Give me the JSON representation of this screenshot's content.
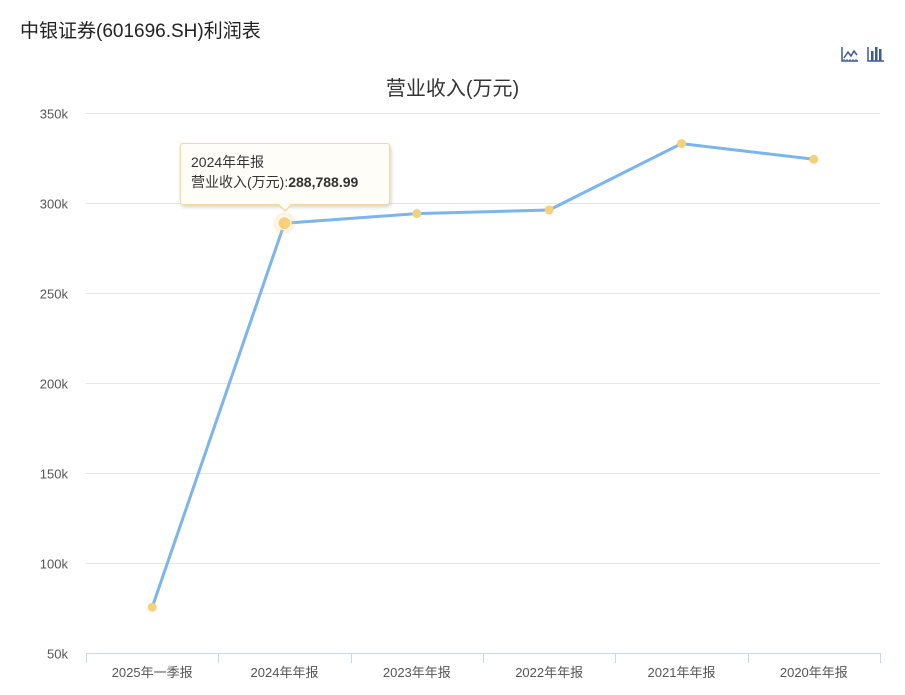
{
  "page": {
    "title": "中银证券(601696.SH)利润表"
  },
  "toolbar": {
    "line_icon": "line-chart-icon",
    "bar_icon": "bar-chart-icon"
  },
  "tooltip": {
    "period": "2024年年报",
    "label": "营业收入(万元):",
    "value": "288,788.99"
  },
  "colors": {
    "line": "#7cb5ec",
    "point": "#f7d07a",
    "tooltip_border": "#f5d89b",
    "icon": "#3c5a99"
  },
  "chart_data": {
    "type": "line",
    "title": "营业收入(万元)",
    "categories": [
      "2025年一季报",
      "2024年年报",
      "2023年年报",
      "2022年年报",
      "2021年年报",
      "2020年年报"
    ],
    "series": [
      {
        "values": [
          75400,
          288788.99,
          294100,
          296100,
          333000,
          324300
        ]
      }
    ],
    "ylim": [
      50000,
      350000
    ],
    "yticks": [
      350000,
      300000,
      250000,
      200000,
      150000,
      100000,
      50000
    ],
    "ytick_labels": [
      "350k",
      "300k",
      "250k",
      "200k",
      "150k",
      "100k",
      "50k"
    ],
    "grid": true,
    "highlighted_index": 1
  }
}
